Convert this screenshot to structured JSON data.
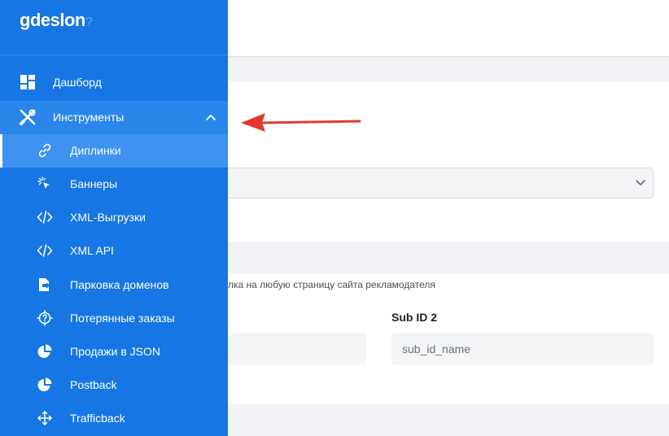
{
  "brand": {
    "logo_text": "gdeslon",
    "logo_mark": "?"
  },
  "sidebar": {
    "items": [
      {
        "label": "Дашборд",
        "icon": "dashboard-icon"
      },
      {
        "label": "Инструменты",
        "icon": "tools-icon",
        "expanded": true
      },
      {
        "label": "Диплинки",
        "icon": "link-icon",
        "active": true
      },
      {
        "label": "Баннеры",
        "icon": "cursor-click-icon"
      },
      {
        "label": "XML-Выгрузки",
        "icon": "code-icon"
      },
      {
        "label": "XML API",
        "icon": "code-icon"
      },
      {
        "label": "Парковка доменов",
        "icon": "domain-parking-icon"
      },
      {
        "label": "Потерянные заказы",
        "icon": "lost-orders-icon"
      },
      {
        "label": "Продажи в JSON",
        "icon": "pie-chart-icon"
      },
      {
        "label": "Postback",
        "icon": "pie-chart-icon"
      },
      {
        "label": "Trafficback",
        "icon": "move-arrows-icon"
      }
    ]
  },
  "main": {
    "hint_text": "лка на любую страницу сайта рекламодателя",
    "sub_id2": {
      "label": "Sub ID 2",
      "placeholder": "sub_id_name"
    }
  },
  "colors": {
    "sidebar_bg": "#1676e3",
    "active_bg": "#3d93ef",
    "arrow": "#e03a2f"
  }
}
